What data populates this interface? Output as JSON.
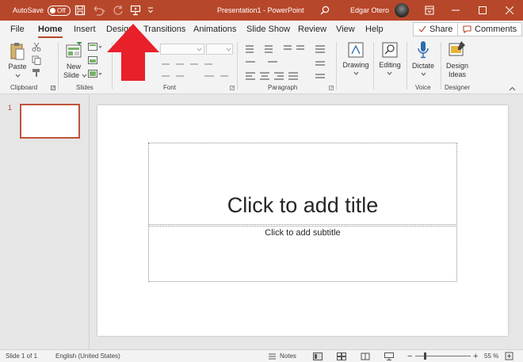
{
  "titlebar": {
    "autosave_label": "AutoSave",
    "autosave_state": "Off",
    "document_title": "Presentation1 - PowerPoint",
    "user_name": "Edgar Otero"
  },
  "tabs": [
    "File",
    "Home",
    "Insert",
    "Design",
    "Transitions",
    "Animations",
    "Slide Show",
    "Review",
    "View",
    "Help"
  ],
  "active_tab": "Home",
  "tab_buttons": {
    "share": "Share",
    "comments": "Comments"
  },
  "ribbon": {
    "clipboard": {
      "label": "Clipboard",
      "paste": "Paste"
    },
    "slides": {
      "label": "Slides",
      "new_slide_line1": "New",
      "new_slide_line2": "Slide"
    },
    "font": {
      "label": "Font"
    },
    "paragraph": {
      "label": "Paragraph"
    },
    "drawing": {
      "label": "Drawing"
    },
    "editing": {
      "label": "Editing"
    },
    "voice": {
      "label": "Voice",
      "dictate": "Dictate"
    },
    "designer": {
      "label": "Designer",
      "line1": "Design",
      "line2": "Ideas"
    }
  },
  "slide_panel": {
    "slide_number": "1"
  },
  "slide": {
    "title_placeholder": "Click to add title",
    "subtitle_placeholder": "Click to add subtitle"
  },
  "statusbar": {
    "slide_info": "Slide 1 of 1",
    "language": "English (United States)",
    "notes": "Notes",
    "zoom": "55 %"
  },
  "colors": {
    "accent": "#b7472a",
    "annotation_arrow": "#e8202a"
  },
  "icons": [
    "save-icon",
    "undo-icon",
    "redo-icon",
    "present-icon",
    "customize-icon",
    "search-icon",
    "ribbon-display-icon",
    "minimize-icon",
    "maximize-icon",
    "close-icon",
    "share-icon",
    "comments-icon",
    "paste-icon",
    "cut-icon",
    "copy-icon",
    "format-painter-icon",
    "new-slide-icon",
    "microphone-icon",
    "design-ideas-icon",
    "red-arrow-annotation"
  ]
}
